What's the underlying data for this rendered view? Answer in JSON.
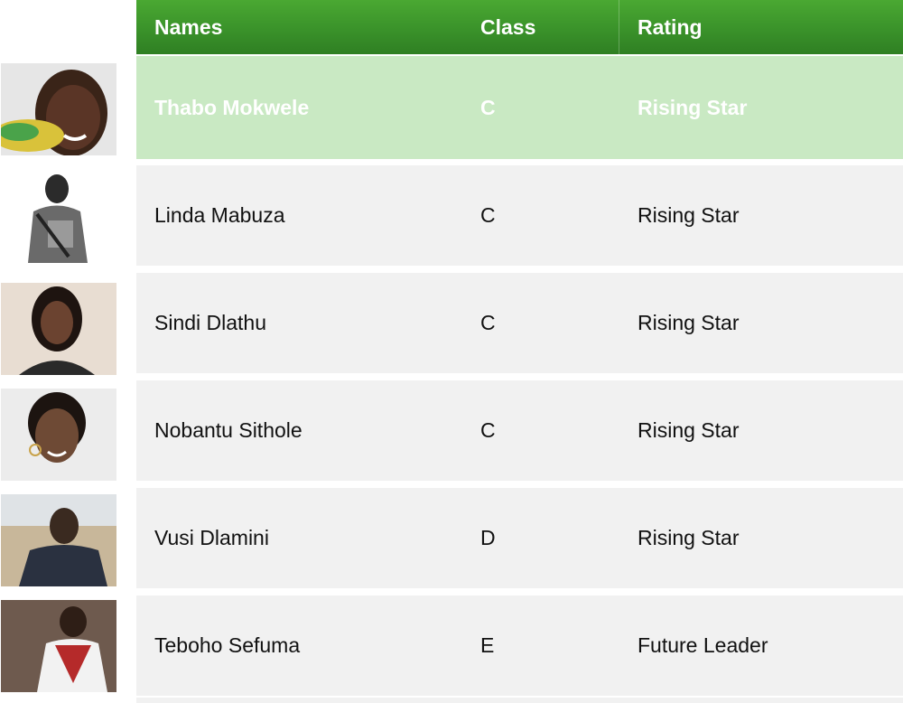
{
  "header": {
    "names_label": "Names",
    "class_label": "Class",
    "rating_label": "Rating"
  },
  "rows": [
    {
      "name": "Thabo Mokwele",
      "class": "C",
      "rating": "Rising Star"
    },
    {
      "name": "Linda Mabuza",
      "class": "C",
      "rating": "Rising Star"
    },
    {
      "name": "Sindi Dlathu",
      "class": "C",
      "rating": "Rising Star"
    },
    {
      "name": "Nobantu Sithole",
      "class": "C",
      "rating": "Rising Star"
    },
    {
      "name": "Vusi Dlamini",
      "class": "D",
      "rating": "Rising Star"
    },
    {
      "name": "Teboho Sefuma",
      "class": "E",
      "rating": "Future Leader"
    }
  ],
  "colors": {
    "header_green": "#3a922a",
    "highlight_row": "#c9e9c3",
    "row_background": "#f1f1f1"
  }
}
